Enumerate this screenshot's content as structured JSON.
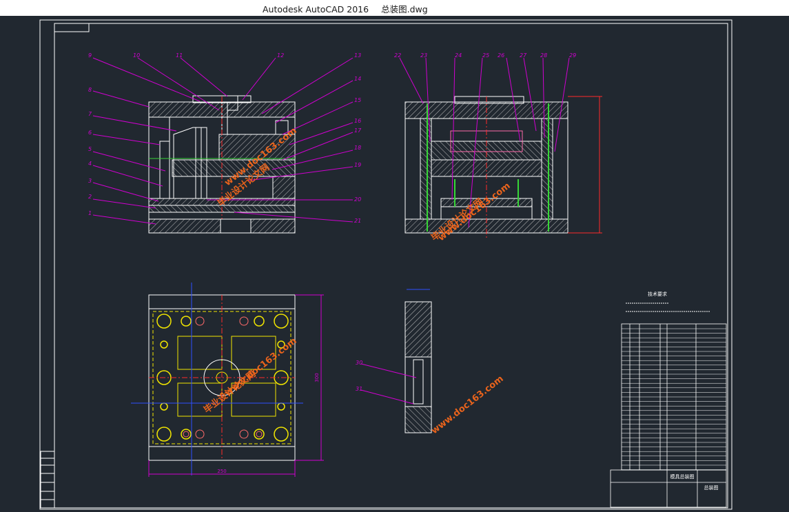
{
  "window": {
    "app_title": "Autodesk AutoCAD 2016",
    "file_name": "总装图.dwg"
  },
  "drawing": {
    "callouts_left": [
      "9",
      "10",
      "11",
      "12",
      "13",
      "14",
      "15",
      "16",
      "17",
      "18",
      "19",
      "20",
      "21",
      "8",
      "7",
      "6",
      "5",
      "4",
      "3",
      "2",
      "1"
    ],
    "callouts_right": [
      "22",
      "23",
      "24",
      "25",
      "26",
      "27",
      "28",
      "29"
    ],
    "callouts_section": [
      "30",
      "31"
    ],
    "dim_width": "250",
    "dim_height": "300",
    "tech_req_title": "技术要求",
    "title_block_heading": "模具总装图",
    "drawing_name": "总装图",
    "watermark_site": "www.doc163.com",
    "watermark_cn": "毕业设计论文网"
  },
  "colors": {
    "canvas": "#212830",
    "frame": "#ffffff",
    "hatch": "#c9c9c9",
    "leader": "#d100d1",
    "yellow": "#f2e600",
    "red": "#ff2a2a",
    "green": "#37d637",
    "blue": "#2f4fff",
    "watermark": "#ff6a1a"
  }
}
